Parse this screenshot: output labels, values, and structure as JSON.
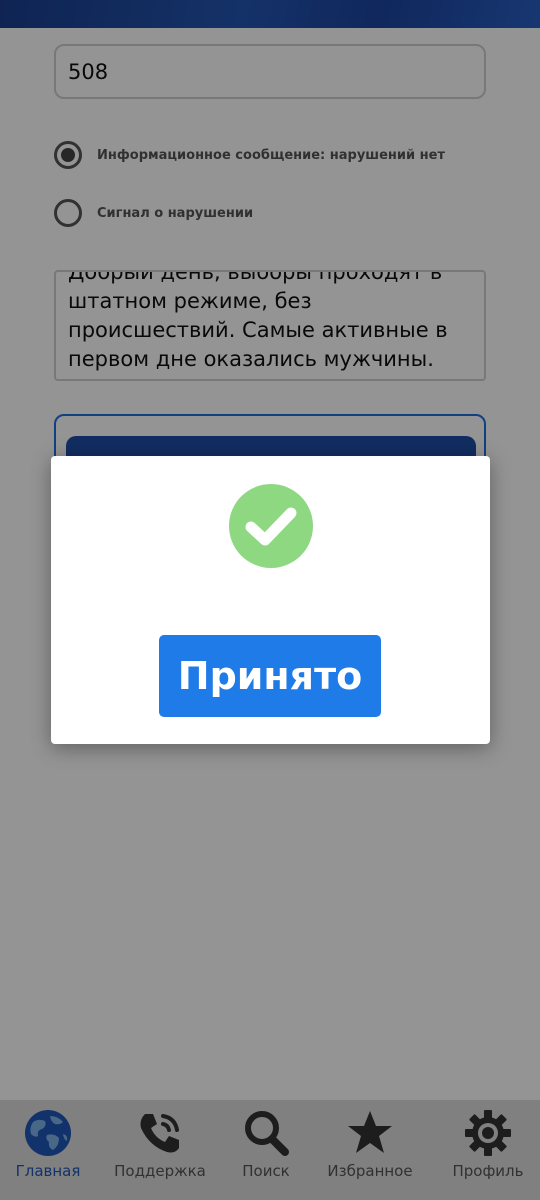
{
  "form": {
    "station_number": "508",
    "radio_options": [
      {
        "label": "Информационное сообщение: нарушений нет",
        "selected": true
      },
      {
        "label": "Сигнал о нарушении",
        "selected": false
      }
    ],
    "message_lines": [
      "Добрый день, выборы проходят в",
      "штатном режиме, без",
      "происшествий. Самые активные в",
      "первом дне оказались мужчины."
    ]
  },
  "modal": {
    "icon": "check-circle-icon",
    "accept_label": "Принято",
    "icon_color": "#8fd882",
    "button_color": "#1f7be8"
  },
  "nav": {
    "items": [
      {
        "label": "Главная",
        "icon": "globe-icon",
        "active": true
      },
      {
        "label": "Поддержка",
        "icon": "phone-icon",
        "active": false
      },
      {
        "label": "Поиск",
        "icon": "search-icon",
        "active": false
      },
      {
        "label": "Избранное",
        "icon": "star-icon",
        "active": false
      },
      {
        "label": "Профиль",
        "icon": "gear-icon",
        "active": false
      }
    ],
    "active_color": "#1f57b8"
  }
}
